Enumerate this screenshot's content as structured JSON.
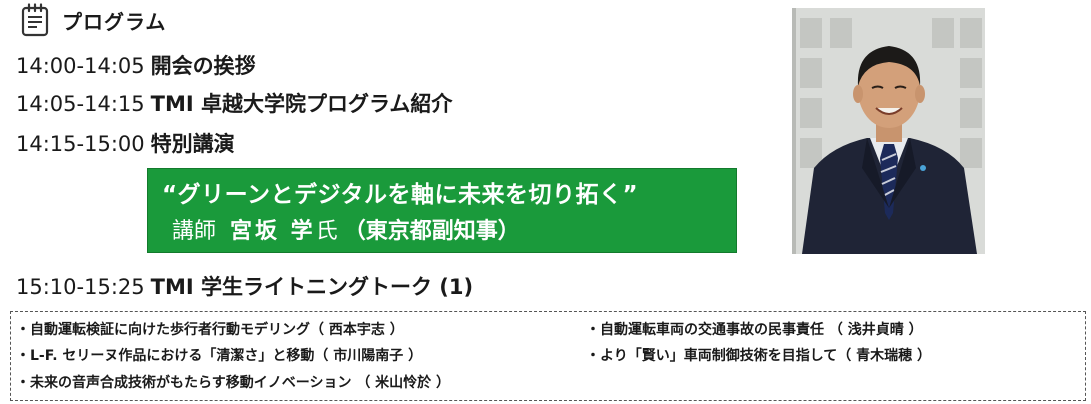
{
  "header": {
    "icon": "notepad-icon",
    "title": "プログラム"
  },
  "schedule": [
    {
      "time": "14:00-14:05",
      "label": "開会の挨拶"
    },
    {
      "time": "14:05-14:15",
      "label": "TMI 卓越大学院プログラム紹介"
    },
    {
      "time": "14:15-15:00",
      "label": "特別講演"
    },
    {
      "time": "15:10-15:25",
      "label": "TMI 学生ライトニングトーク (1)"
    }
  ],
  "special_lecture": {
    "title": "“グリーンとデジタルを軸に未来を切り拓く”",
    "role": "講師",
    "name": "宮坂 学",
    "honorific": "氏",
    "position": "（東京都副知事）",
    "box_color": "#1a9a3b"
  },
  "photo": {
    "icon": "speaker-portrait"
  },
  "talks": [
    "・自動運転検証に向けた歩行者行動モデリング（ 西本宇志 ）",
    "・自動運転車両の交通事故の民事責任 （ 浅井貞晴 ）",
    "・L-F. セリーヌ作品における「清潔さ」と移動（ 市川陽南子 ）",
    "・より「賢い」車両制御技術を目指して（ 青木瑞穂 ）",
    "・未来の音声合成技術がもたらす移動イノベーション （ 米山怜於 ）"
  ]
}
